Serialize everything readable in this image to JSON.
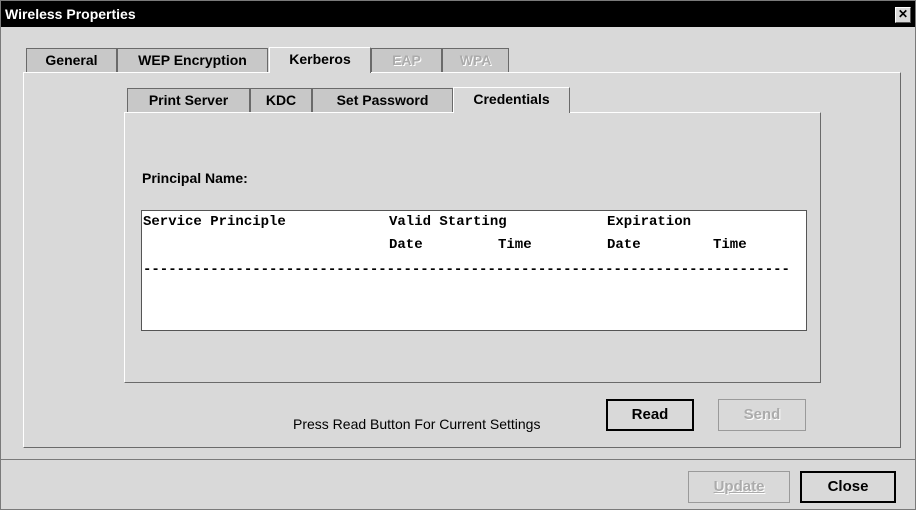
{
  "window": {
    "title": "Wireless Properties",
    "close_glyph": "✕"
  },
  "main_tabs": [
    {
      "label": "General",
      "state": "normal"
    },
    {
      "label": "WEP Encryption",
      "state": "normal"
    },
    {
      "label": "Kerberos",
      "state": "selected"
    },
    {
      "label": "EAP",
      "state": "disabled"
    },
    {
      "label": "WPA",
      "state": "disabled"
    }
  ],
  "sub_tabs": [
    {
      "label": "Print Server",
      "state": "normal"
    },
    {
      "label": "KDC",
      "state": "normal"
    },
    {
      "label": "Set Password",
      "state": "normal"
    },
    {
      "label": "Credentials",
      "state": "selected"
    }
  ],
  "credentials": {
    "principal_label": "Principal Name:",
    "principal_value": "",
    "header_service": "Service Principle",
    "header_valid": "Valid Starting",
    "header_expiration": "Expiration",
    "sub_date1": "Date",
    "sub_time1": "Time",
    "sub_date2": "Date",
    "sub_time2": "Time",
    "dashes": "-----------------------------------------------------------------------------------------"
  },
  "footer": {
    "hint": "Press Read Button For Current Settings",
    "read_label": "Read",
    "send_label": "Send",
    "update_label": "Update",
    "close_label": "Close"
  }
}
